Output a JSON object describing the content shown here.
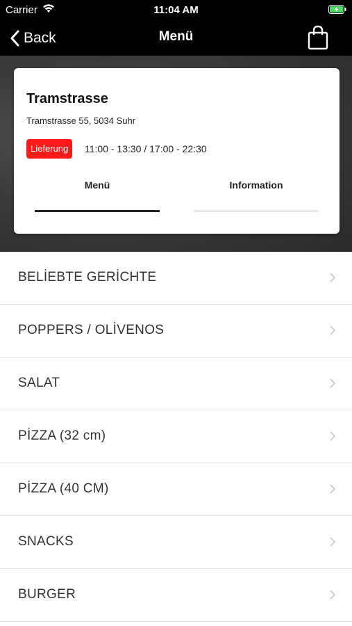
{
  "status_bar": {
    "carrier": "Carrier",
    "time": "11:04 AM",
    "wifi_icon": "wifi-icon",
    "battery_icon": "battery-charging-icon"
  },
  "nav": {
    "back_label": "Back",
    "title": "Menü",
    "bag_icon": "shopping-bag-icon"
  },
  "restaurant": {
    "name": "Tramstrasse",
    "address": "Tramstrasse 55, 5034 Suhr",
    "badge": "Lieferung",
    "hours": "11:00 - 13:30 / 17:00 - 22:30"
  },
  "tabs": [
    {
      "label": "Menü",
      "active": true
    },
    {
      "label": "Information",
      "active": false
    }
  ],
  "categories": [
    "BELİEBTE GERİCHTE",
    "POPPERS / OLİVENOS",
    "SALAT",
    "PİZZA (32 cm)",
    "PİZZA (40 CM)",
    "SNACKS",
    "BURGER"
  ],
  "colors": {
    "badge_red": "#ff1a1a",
    "nav_black": "#000000",
    "text_dark": "#333333"
  }
}
